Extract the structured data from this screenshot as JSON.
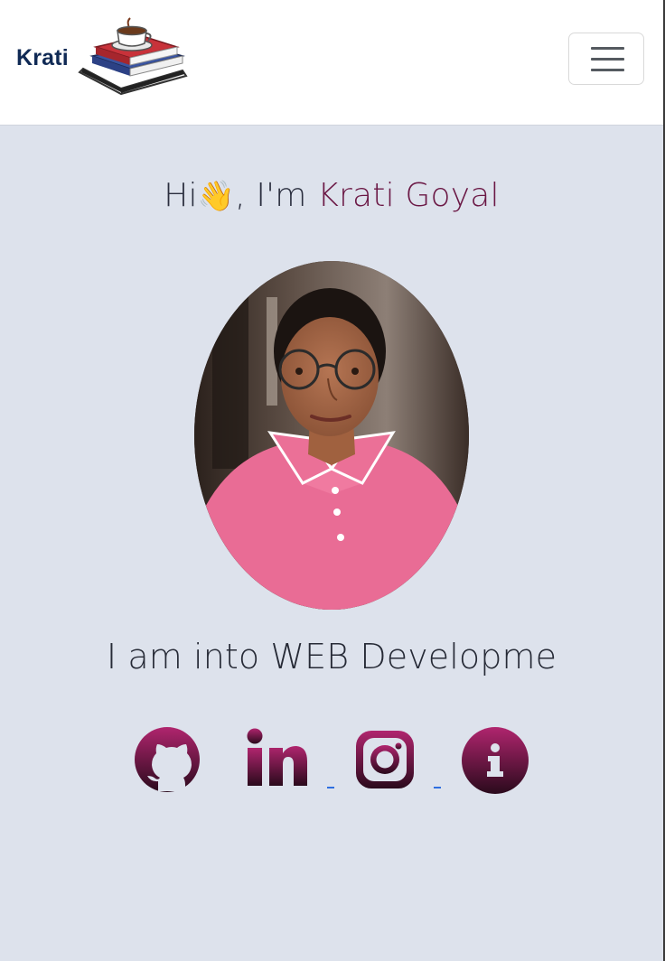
{
  "navbar": {
    "brand_text": "Krati",
    "toggle_icon": "hamburger-menu-icon"
  },
  "hero": {
    "greeting_prefix": "Hi",
    "greeting_emoji": "👋",
    "greeting_middle": ", I'm ",
    "name": "Krati Goyal",
    "subtitle": "I am into WEB Developme"
  },
  "social_links": [
    {
      "icon": "github-icon"
    },
    {
      "icon": "linkedin-icon"
    },
    {
      "icon": "instagram-icon"
    },
    {
      "icon": "info-icon"
    }
  ],
  "colors": {
    "page_background": "#dde2ec",
    "navbar_background": "#ffffff",
    "name_highlight": "#6b1845",
    "icon_gradient_top": "#b0256e",
    "icon_gradient_bottom": "#2a0a1c",
    "link_dash": "#2f6fe0"
  }
}
